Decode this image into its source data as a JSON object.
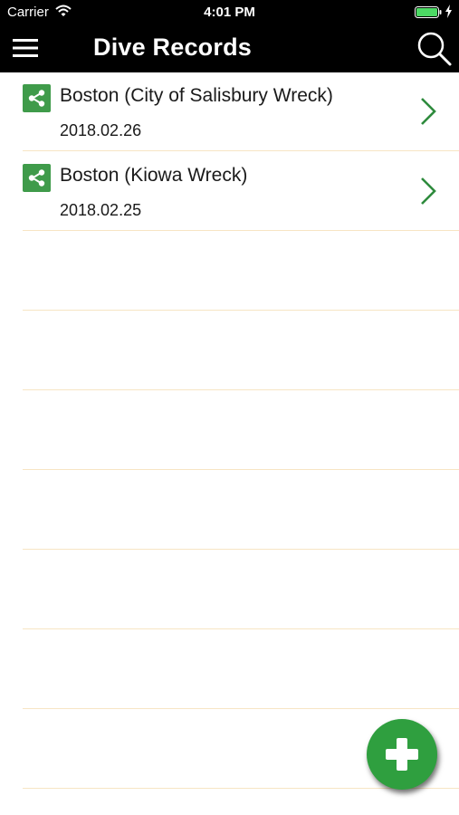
{
  "status_bar": {
    "carrier": "Carrier",
    "time": "4:01 PM",
    "icons": [
      "wifi-icon",
      "battery-icon",
      "charging-bolt-icon"
    ]
  },
  "nav_bar": {
    "title": "Dive Records",
    "left_icon": "menu-icon",
    "right_icon": "search-icon"
  },
  "records": [
    {
      "title": "Boston (City of Salisbury Wreck)",
      "date": "2018.02.26",
      "icon": "share-icon",
      "accessory": "chevron-right-icon"
    },
    {
      "title": "Boston (Kiowa Wreck)",
      "date": "2018.02.25",
      "icon": "share-icon",
      "accessory": "chevron-right-icon"
    }
  ],
  "fab": {
    "icon": "plus-icon"
  },
  "colors": {
    "bar_background": "#000000",
    "accent_green": "#3f9b4a",
    "fab_green": "#2f9f3f",
    "separator": "#f7e5c4",
    "chevron_green": "#2e8b3d"
  }
}
